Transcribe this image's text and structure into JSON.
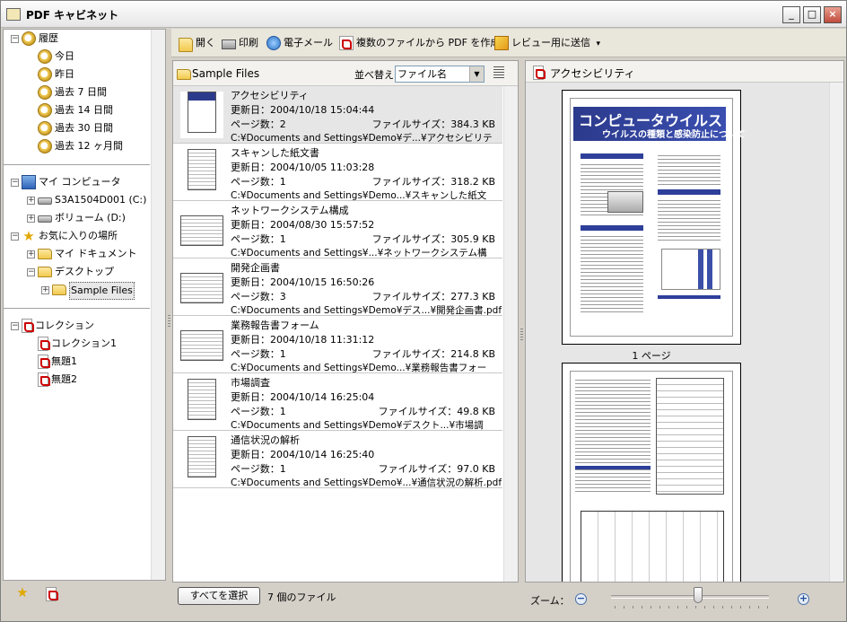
{
  "window": {
    "title": "PDF キャビネット"
  },
  "titlebar_buttons": {
    "minimize": "_",
    "maximize": "□",
    "close": "×"
  },
  "tree": {
    "history": {
      "label": "履歴",
      "items": [
        "今日",
        "昨日",
        "過去 7 日間",
        "過去 14 日間",
        "過去 30 日間",
        "過去 12 ヶ月間"
      ]
    },
    "computer": {
      "label": "マイ コンピュータ",
      "items": [
        "S3A1504D001 (C:)",
        "ボリューム (D:)"
      ]
    },
    "favorites": {
      "label": "お気に入りの場所",
      "items": [
        "マイ ドキュメント",
        "デスクトップ",
        "Sample Files"
      ]
    },
    "collections": {
      "label": "コレクション",
      "items": [
        "コレクション1",
        "無題1",
        "無題2"
      ]
    },
    "expanders": {
      "expanded": "−",
      "collapsed": "+"
    }
  },
  "toolbar": {
    "open": "開く",
    "print": "印刷",
    "email": "電子メール",
    "combine": "複数のファイルから PDF を作成",
    "review": "レビュー用に送信",
    "review_arrow": "▾"
  },
  "file_list": {
    "folder": "Sample Files",
    "sort_label": "並べ替え",
    "sort_value": "ファイル名",
    "sort_arrow": "▼",
    "files": [
      {
        "name": "アクセシビリティ",
        "date": "更新日：2004/10/18 15:04:44",
        "pages": "ページ数：2",
        "size": "ファイルサイズ：384.3 KB",
        "path": "C:¥Documents and Settings¥Demo¥デ...¥アクセシビリティ.pdf"
      },
      {
        "name": "スキャンした紙文書",
        "date": "更新日：2004/10/05 11:03:28",
        "pages": "ページ数：1",
        "size": "ファイルサイズ：318.2 KB",
        "path": "C:¥Documents and Settings¥Demo...¥スキャンした紙文書.pdf"
      },
      {
        "name": "ネットワークシステム構成",
        "date": "更新日：2004/08/30 15:57:52",
        "pages": "ページ数：1",
        "size": "ファイルサイズ：305.9 KB",
        "path": "C:¥Documents and Settings¥...¥ネットワークシステム構成.pdf"
      },
      {
        "name": "開発企画書",
        "date": "更新日：2004/10/15 16:50:26",
        "pages": "ページ数：3",
        "size": "ファイルサイズ：277.3 KB",
        "path": "C:¥Documents and Settings¥Demo¥デス...¥開発企画書.pdf"
      },
      {
        "name": "業務報告書フォーム",
        "date": "更新日：2004/10/18 11:31:12",
        "pages": "ページ数：1",
        "size": "ファイルサイズ：214.8 KB",
        "path": "C:¥Documents and Settings¥Demo...¥業務報告書フォーム.pdf"
      },
      {
        "name": "市場調査",
        "date": "更新日：2004/10/14 16:25:04",
        "pages": "ページ数：1",
        "size": "ファイルサイズ：49.8 KB",
        "path": "C:¥Documents and Settings¥Demo¥デスクト...¥市場調査.pdf"
      },
      {
        "name": "通信状況の解析",
        "date": "更新日：2004/10/14 16:25:40",
        "pages": "ページ数：1",
        "size": "ファイルサイズ：97.0 KB",
        "path": "C:¥Documents and Settings¥Demo¥...¥通信状況の解析.pdf"
      }
    ],
    "select_all": "すべてを選択",
    "count": "7 個のファイル"
  },
  "preview": {
    "title": "アクセシビリティ",
    "cover_title": "コンピュータウイルス",
    "cover_subtitle": "ウイルスの種類と感染防止について",
    "page_label": "1 ページ",
    "zoom_label": "ズーム：",
    "zoom_out": "−",
    "zoom_in": "+",
    "zoom_level": 0.55
  }
}
